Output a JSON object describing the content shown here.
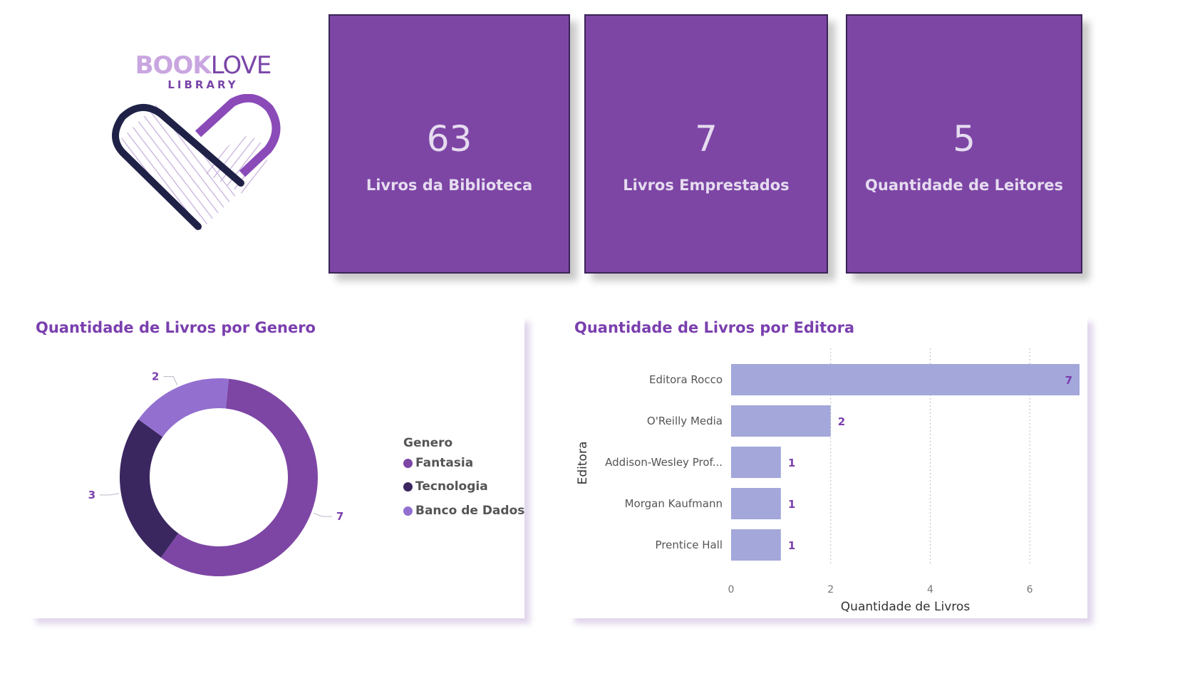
{
  "logo": {
    "word1": "BOOK",
    "word2": "LOVE",
    "sub": "LIBRARY"
  },
  "kpis": [
    {
      "value": "63",
      "label": "Livros da Biblioteca"
    },
    {
      "value": "7",
      "label": "Livros Emprestados"
    },
    {
      "value": "5",
      "label": "Quantidade de Leitores"
    }
  ],
  "colors": {
    "kpi_bg": "#7d46a5",
    "fantasia": "#7d46a5",
    "tecnologia": "#3b2760",
    "banco_de_dados": "#9370d0",
    "bar": "#a3a7da",
    "title": "#7a3fae"
  },
  "chart_data": [
    {
      "type": "pie",
      "title": "Quantidade de Livros por Genero",
      "legend_title": "Genero",
      "legend_position": "right",
      "categories": [
        "Fantasia",
        "Tecnologia",
        "Banco de Dados"
      ],
      "values": [
        7,
        3,
        2
      ]
    },
    {
      "type": "bar",
      "orientation": "horizontal",
      "title": "Quantidade de Livros por Editora",
      "categories": [
        "Editora Rocco",
        "O'Reilly Media",
        "Addison-Wesley Prof...",
        "Morgan Kaufmann",
        "Prentice Hall"
      ],
      "values": [
        7,
        2,
        1,
        1,
        1
      ],
      "xlabel": "Quantidade de Livros",
      "ylabel": "Editora",
      "xlim": [
        0,
        7
      ],
      "xticks": [
        0,
        2,
        4,
        6
      ],
      "grid": true
    }
  ]
}
